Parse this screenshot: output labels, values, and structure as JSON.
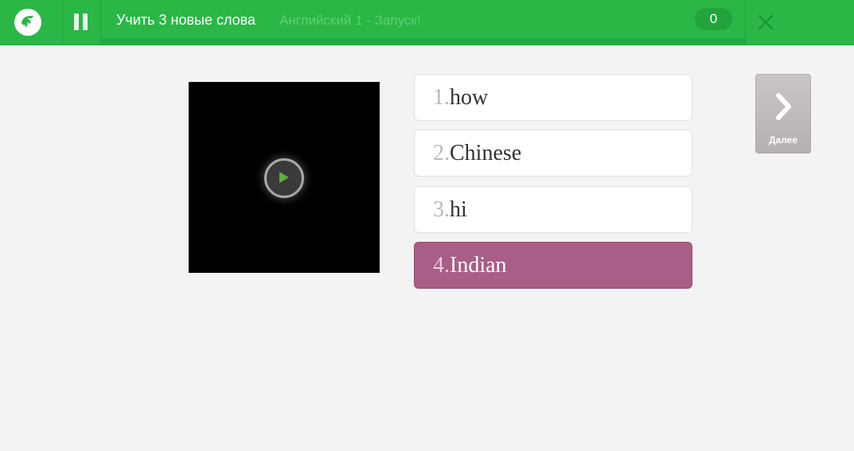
{
  "header": {
    "title": "Учить 3 новые слова",
    "subtitle": "Английский 1 - Запуск!",
    "score": "0",
    "progress": 0,
    "logo_icon": "memrise-logo-icon",
    "pause_icon": "pause-icon",
    "close_icon": "close-icon"
  },
  "media": {
    "play_icon": "play-icon"
  },
  "options": [
    {
      "number": "1.",
      "word": "how",
      "selected": false
    },
    {
      "number": "2.",
      "word": "Chinese",
      "selected": false
    },
    {
      "number": "3.",
      "word": "hi",
      "selected": false
    },
    {
      "number": "4.",
      "word": "Indian",
      "selected": true
    }
  ],
  "next": {
    "label": "Далее",
    "icon": "chevron-right-icon"
  },
  "colors": {
    "header": "#2ab745",
    "selected_option": "#a85e86",
    "background": "#f3f3f3"
  }
}
